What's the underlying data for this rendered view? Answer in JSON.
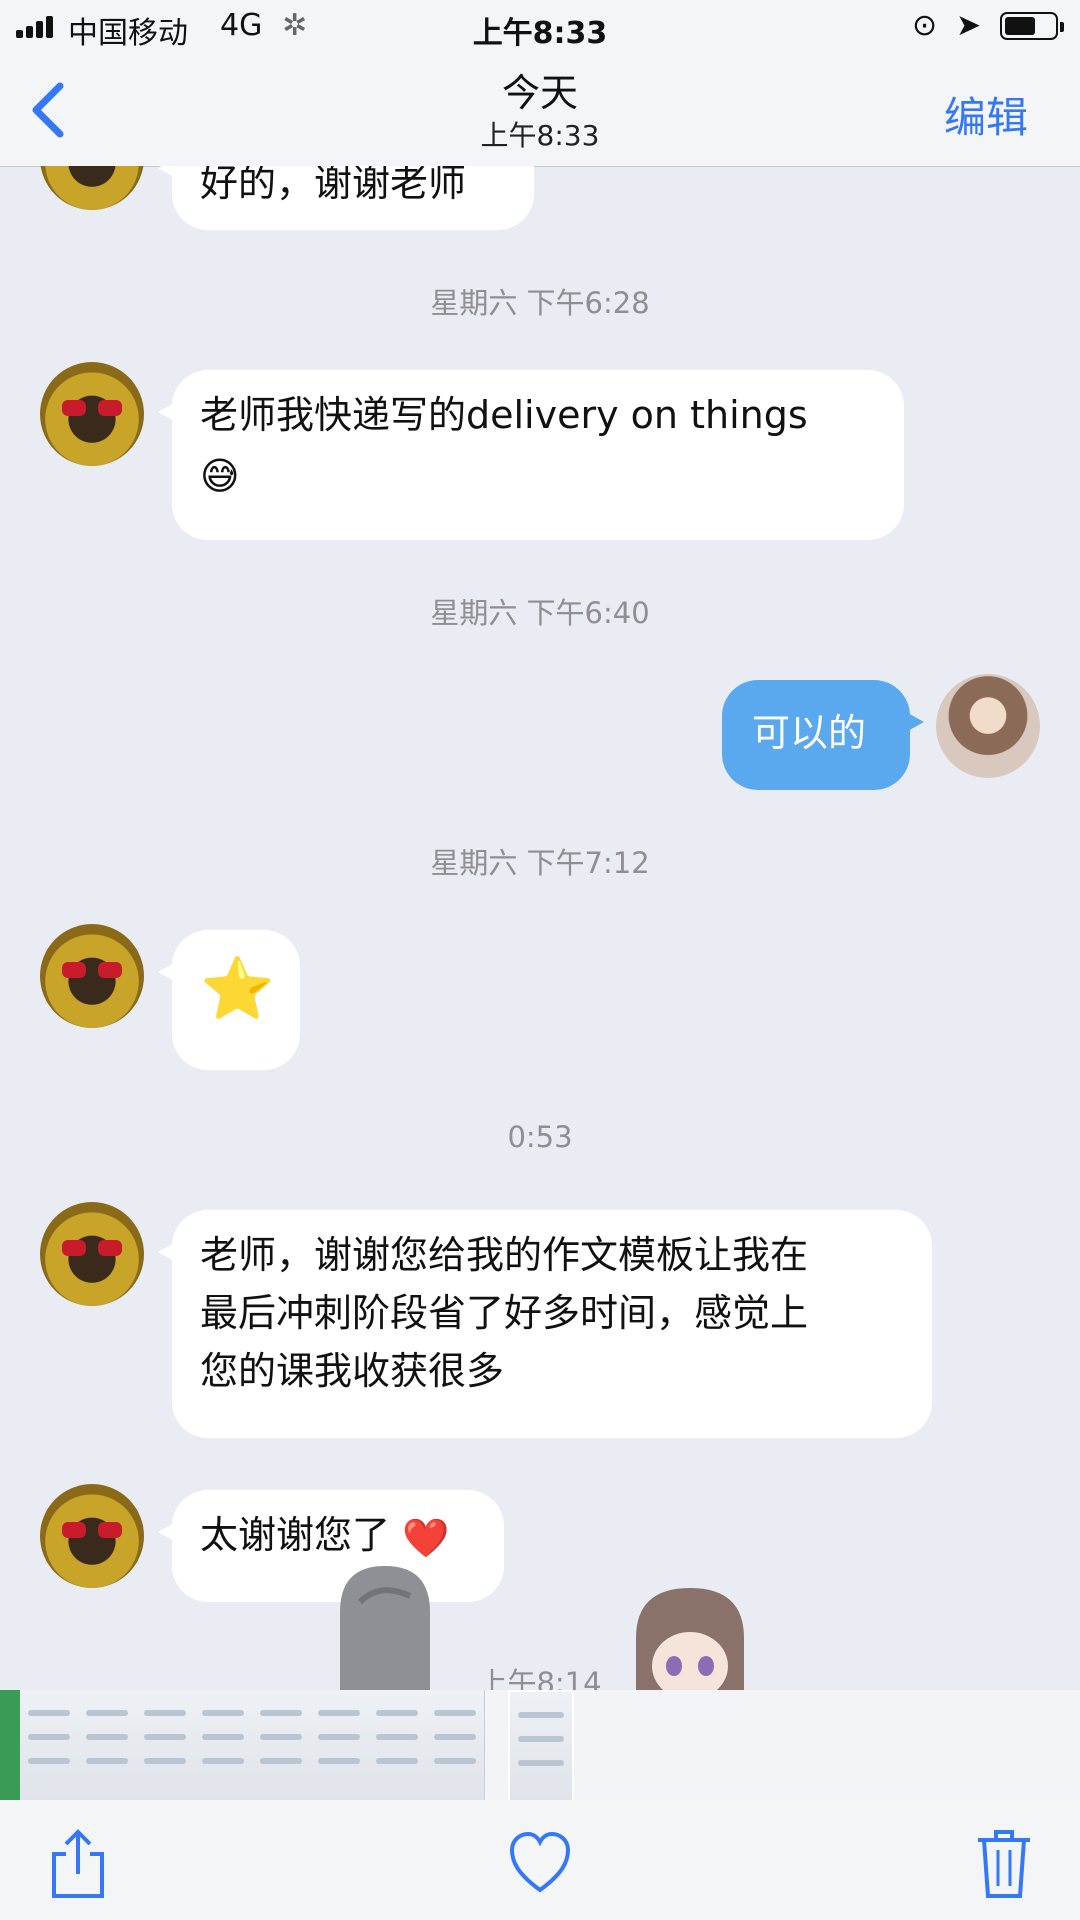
{
  "status_bar": {
    "carrier": "中国移动",
    "network": "4G",
    "time": "上午8:33"
  },
  "nav": {
    "back_icon": "chevron-left-icon",
    "title": "今天",
    "subtitle": "上午8:33",
    "edit_label": "编辑"
  },
  "messages": {
    "partial_top": "好的，谢谢老师",
    "ts1": "星期六 下午6:28",
    "msg1_text": "老师我快递写的delivery on things",
    "msg1_emoji": "😅",
    "ts2": "星期六 下午6:40",
    "msg2_text": "可以的",
    "ts3": "星期六 下午7:12",
    "msg3_emoji": "⭐",
    "ts4": "0:53",
    "msg4_line1": "老师，谢谢您给我的作文模板让我在",
    "msg4_line2": "最后冲刺阶段省了好多时间，感觉上",
    "msg4_line3": "您的课我收获很多",
    "msg5_text": "太谢谢您了",
    "msg5_emoji": "❤️",
    "ts5": "上午8:14"
  },
  "colors": {
    "accent": "#3478f6",
    "outgoing_bubble": "#5aa9ee",
    "incoming_bubble": "#ffffff",
    "background": "#e9edf3"
  },
  "toolbar": {
    "share_icon": "share-icon",
    "like_icon": "heart-icon",
    "delete_icon": "trash-icon"
  }
}
